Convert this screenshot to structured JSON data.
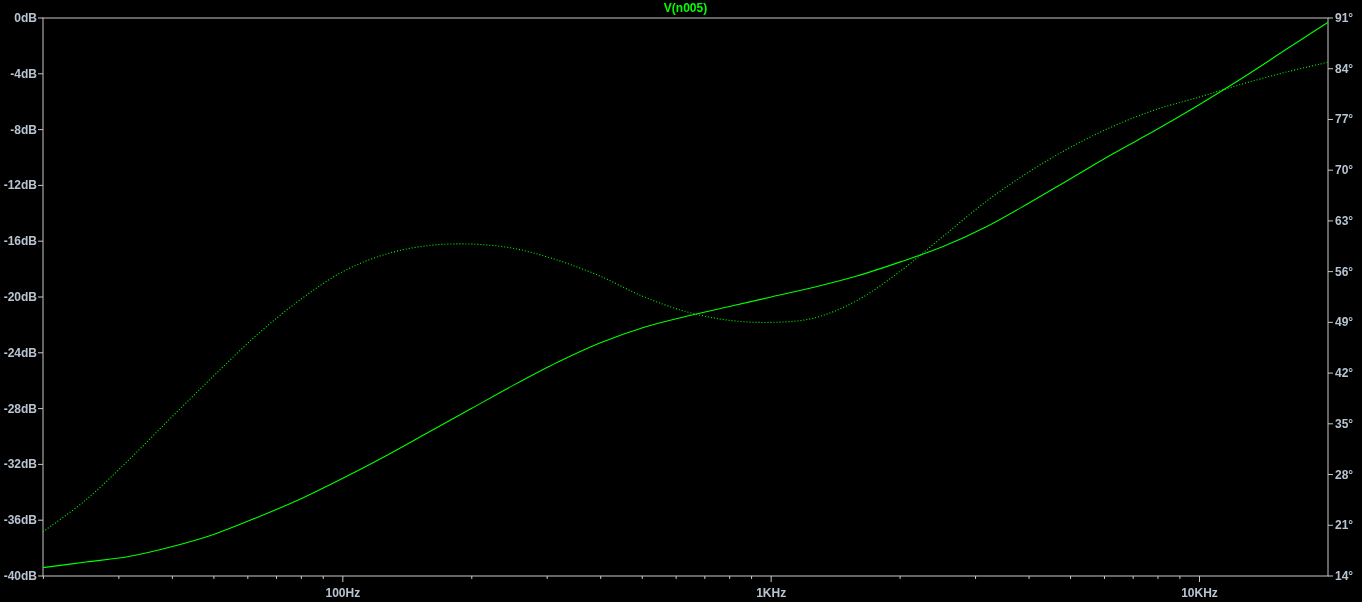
{
  "plot": {
    "chart_data": {
      "type": "line",
      "title": "V(n005)",
      "categories": [
        null,
        null,
        null,
        null,
        null,
        null,
        null,
        "100Hz",
        null,
        null,
        null,
        null,
        null,
        null,
        null,
        null,
        null,
        "1KHz",
        null,
        null,
        null,
        null,
        null,
        null,
        null,
        null,
        null,
        "10KHz",
        null,
        null,
        null
      ],
      "ylim": [
        -40,
        0
      ],
      "yticks": [
        {
          "value": 0,
          "label": "0dB"
        },
        {
          "value": -4,
          "label": "-4dB"
        },
        {
          "value": -8,
          "label": "-8dB"
        },
        {
          "value": -12,
          "label": "-12dB"
        },
        {
          "value": -16,
          "label": "-16dB"
        },
        {
          "value": -20,
          "label": "-20dB"
        },
        {
          "value": -24,
          "label": "-24dB"
        },
        {
          "value": -28,
          "label": "-28dB"
        },
        {
          "value": -32,
          "label": "-32dB"
        },
        {
          "value": -36,
          "label": "-36dB"
        },
        {
          "value": -40,
          "label": "-40dB"
        }
      ],
      "y2lim": [
        14,
        91
      ],
      "y2ticks": [
        {
          "value": 91,
          "label": "91°"
        },
        {
          "value": 84,
          "label": "84°"
        },
        {
          "value": 77,
          "label": "77°"
        },
        {
          "value": 70,
          "label": "70°"
        },
        {
          "value": 63,
          "label": "63°"
        },
        {
          "value": 56,
          "label": "56°"
        },
        {
          "value": 49,
          "label": "49°"
        },
        {
          "value": 42,
          "label": "42°"
        },
        {
          "value": 35,
          "label": "35°"
        },
        {
          "value": 28,
          "label": "28°"
        },
        {
          "value": 21,
          "label": "21°"
        },
        {
          "value": 14,
          "label": "14°"
        }
      ],
      "series": [
        {
          "color": "#00ff00",
          "values": [
            -39.4,
            -39.0,
            -38.6,
            -37.9,
            -37.0,
            -35.8,
            -34.5,
            -33.0,
            -31.4,
            -29.7,
            -28.0,
            -26.3,
            -24.7,
            -23.3,
            -22.2,
            -21.4,
            -20.7,
            -20.0,
            -19.3,
            -18.5,
            -17.5,
            -16.4,
            -15.0,
            -13.3,
            -11.5,
            -9.7,
            -8.0,
            -6.2,
            -4.3,
            -2.3,
            -0.3
          ]
        },
        {
          "axis": "y2",
          "color": "#00ff00",
          "line_style": "dotted",
          "values": [
            20.1,
            24.5,
            30.0,
            35.9,
            41.7,
            47.3,
            52.1,
            56.0,
            58.4,
            59.6,
            59.8,
            59.2,
            57.6,
            55.4,
            52.6,
            50.5,
            49.3,
            49.0,
            49.6,
            52.0,
            56.0,
            60.8,
            65.6,
            69.7,
            73.2,
            76.1,
            78.4,
            80.1,
            81.9,
            83.5,
            84.9
          ]
        }
      ]
    }
  }
}
